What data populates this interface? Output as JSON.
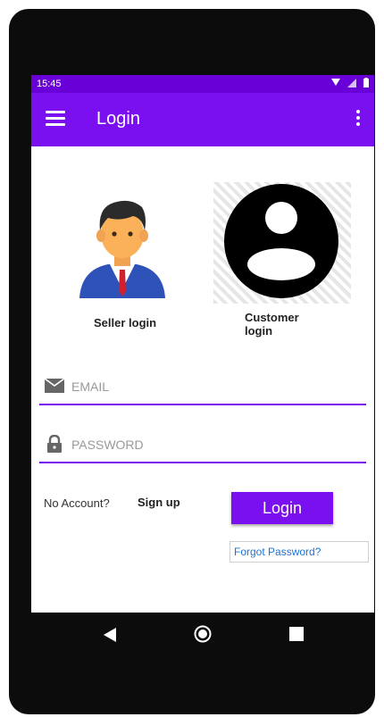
{
  "status_bar": {
    "time": "15:45"
  },
  "app_bar": {
    "title": "Login"
  },
  "roles": {
    "seller_label": "Seller login",
    "customer_label": "Customer login"
  },
  "form": {
    "email_placeholder": "EMAIL",
    "password_placeholder": "PASSWORD"
  },
  "actions": {
    "no_account_text": "No Account?",
    "sign_up_label": "Sign up",
    "login_label": "Login",
    "forgot_password_label": "Forgot Password?"
  },
  "colors": {
    "primary": "#7a0ff0",
    "status_bar": "#6a00d8",
    "link": "#1b74d6"
  },
  "icons": {
    "menu": "hamburger-menu-icon",
    "overflow": "more-vert-icon",
    "email": "envelope-icon",
    "password": "lock-icon",
    "nav_back": "triangle-back-icon",
    "nav_home": "circle-home-icon",
    "nav_recents": "square-recents-icon"
  }
}
